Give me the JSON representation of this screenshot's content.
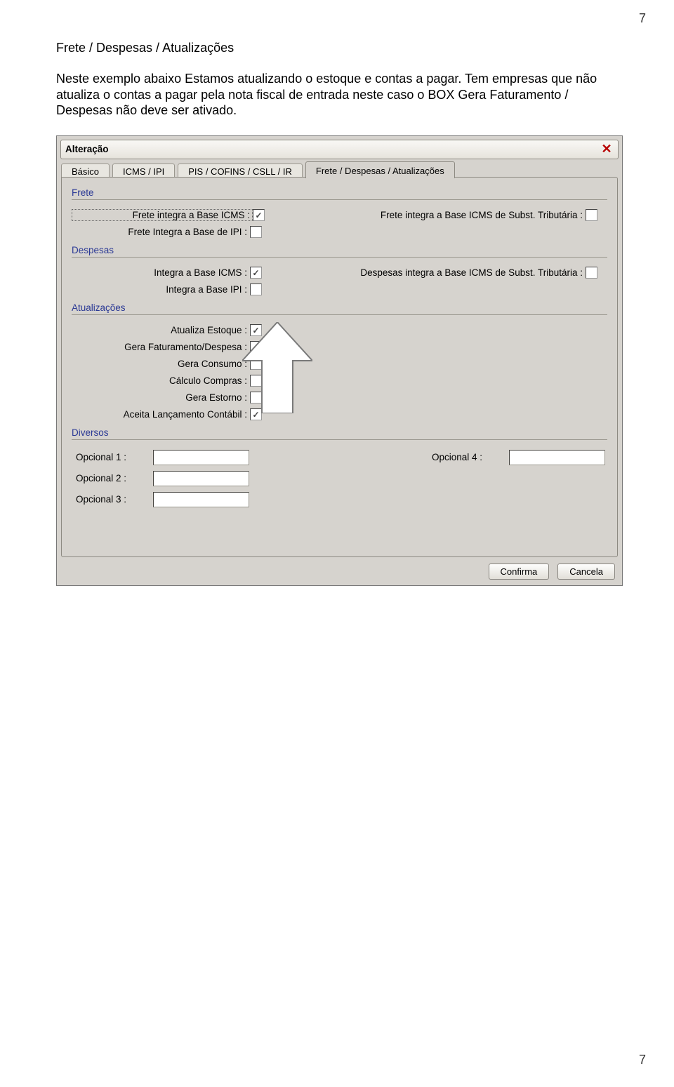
{
  "page": {
    "num": "7"
  },
  "heading": "Frete / Despesas / Atualizações",
  "paragraph": "Neste exemplo abaixo Estamos atualizando o estoque e contas a pagar. Tem empresas que não atualiza o contas a pagar pela nota fiscal de entrada neste caso o BOX Gera Faturamento / Despesas não deve ser ativado.",
  "shot": {
    "title": "Alteração",
    "tabs": {
      "t1": "Básico",
      "t2": "ICMS / IPI",
      "t3": "PIS / COFINS / CSLL / IR",
      "t4": "Frete / Despesas / Atualizações"
    },
    "frete": {
      "section": "Frete",
      "l1": "Frete integra a Base ICMS :",
      "l1r": "Frete integra a Base ICMS de Subst. Tributária :",
      "l2": "Frete Integra a Base de IPI :"
    },
    "despesas": {
      "section": "Despesas",
      "l1": "Integra a Base ICMS :",
      "l1r": "Despesas integra a Base ICMS de Subst. Tributária :",
      "l2": "Integra a Base IPI :"
    },
    "atualizacoes": {
      "section": "Atualizações",
      "l1": "Atualiza Estoque :",
      "l2": "Gera Faturamento/Despesa :",
      "l3": "Gera Consumo :",
      "l4": "Cálculo Compras :",
      "l5": "Gera Estorno :",
      "l6": "Aceita Lançamento Contábil :"
    },
    "diversos": {
      "section": "Diversos",
      "l1": "Opcional 1 :",
      "l2": "Opcional 2 :",
      "l3": "Opcional 3 :",
      "l4": "Opcional 4 :"
    },
    "buttons": {
      "confirm": "Confirma",
      "cancel": "Cancela"
    }
  }
}
